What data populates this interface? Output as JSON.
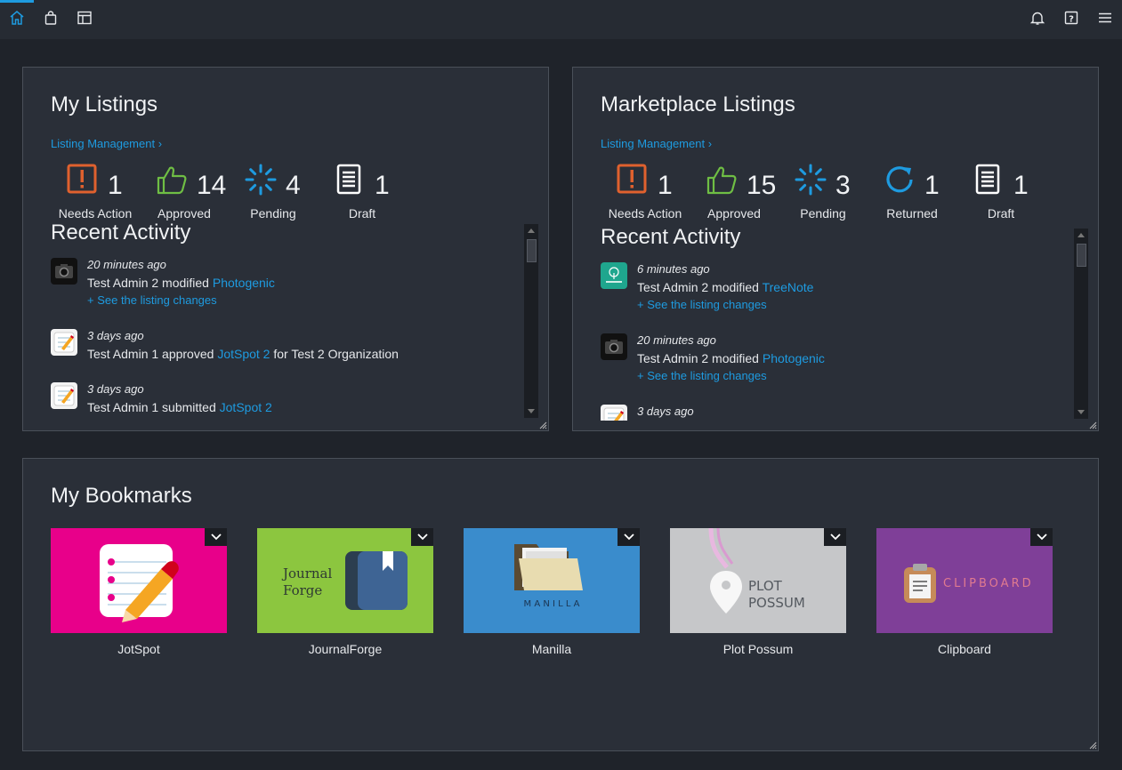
{
  "topbar": {
    "left_icons": [
      "home-icon",
      "shopping-bag-icon",
      "layout-icon"
    ],
    "right_icons": [
      "bell-icon",
      "help-icon",
      "menu-icon"
    ],
    "accent": "#1e9be0"
  },
  "my_listings": {
    "title": "My Listings",
    "management_link": "Listing Management",
    "stats": [
      {
        "icon": "alert-icon",
        "value": "1",
        "label": "Needs Action",
        "color": "#e0612e"
      },
      {
        "icon": "thumbs-up-icon",
        "value": "14",
        "label": "Approved",
        "color": "#6fbe44"
      },
      {
        "icon": "pending-spinner-icon",
        "value": "4",
        "label": "Pending",
        "color": "#1e9be0"
      },
      {
        "icon": "document-icon",
        "value": "1",
        "label": "Draft",
        "color": "#ffffff"
      }
    ],
    "activity_title": "Recent Activity",
    "activity": [
      {
        "icon": "camera-icon",
        "time": "20 minutes ago",
        "text": "Test Admin 2 modified",
        "link": "Photogenic",
        "suffix": "",
        "changes": "+ See the listing changes"
      },
      {
        "icon": "notepad-icon",
        "time": "3 days ago",
        "text": "Test Admin 1 approved",
        "link": "JotSpot 2",
        "suffix": "for Test 2 Organization",
        "changes": ""
      },
      {
        "icon": "notepad-icon",
        "time": "3 days ago",
        "text": "Test Admin 1 submitted",
        "link": "JotSpot 2",
        "suffix": "",
        "changes": ""
      }
    ]
  },
  "marketplace_listings": {
    "title": "Marketplace Listings",
    "management_link": "Listing Management",
    "stats": [
      {
        "icon": "alert-icon",
        "value": "1",
        "label": "Needs Action",
        "color": "#e0612e"
      },
      {
        "icon": "thumbs-up-icon",
        "value": "15",
        "label": "Approved",
        "color": "#6fbe44"
      },
      {
        "icon": "pending-spinner-icon",
        "value": "3",
        "label": "Pending",
        "color": "#1e9be0"
      },
      {
        "icon": "returned-icon",
        "value": "1",
        "label": "Returned",
        "color": "#1e9be0"
      },
      {
        "icon": "document-icon",
        "value": "1",
        "label": "Draft",
        "color": "#ffffff"
      }
    ],
    "activity_title": "Recent Activity",
    "activity": [
      {
        "icon": "treenote-icon",
        "time": "6 minutes ago",
        "text": "Test Admin 2 modified",
        "link": "TreeNote",
        "suffix": "",
        "changes": "+ See the listing changes"
      },
      {
        "icon": "camera-icon",
        "time": "20 minutes ago",
        "text": "Test Admin 2 modified",
        "link": "Photogenic",
        "suffix": "",
        "changes": "+ See the listing changes"
      },
      {
        "icon": "notepad-icon",
        "time": "3 days ago",
        "text": "",
        "link": "",
        "suffix": "",
        "changes": ""
      }
    ]
  },
  "bookmarks": {
    "title": "My Bookmarks",
    "items": [
      {
        "name": "JotSpot",
        "color": "#e8008a"
      },
      {
        "name": "JournalForge",
        "color": "#8cc63f",
        "tile_text_1": "Journal",
        "tile_text_2": "Forge"
      },
      {
        "name": "Manilla",
        "color": "#3a8ccc",
        "tile_text": "M A N I L L A"
      },
      {
        "name": "Plot Possum",
        "color": "#c6c7c9",
        "tile_text_1": "PLOT",
        "tile_text_2": "POSSUM"
      },
      {
        "name": "Clipboard",
        "color": "#7f3f98",
        "tile_text": "CLIPBOARD"
      }
    ]
  }
}
